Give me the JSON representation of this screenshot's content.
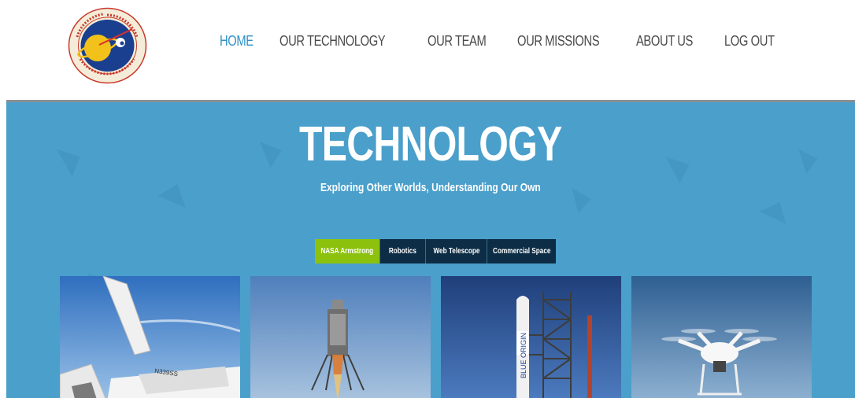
{
  "nav": {
    "items": [
      {
        "label": "HOME",
        "active": true
      },
      {
        "label": "OUR TECHNOLOGY",
        "active": false
      },
      {
        "label": "OUR TEAM",
        "active": false
      },
      {
        "label": "OUR MISSIONS",
        "active": false
      },
      {
        "label": "ABOUT US",
        "active": false
      },
      {
        "label": "LOG OUT",
        "active": false
      }
    ]
  },
  "hero": {
    "title": "TECHNOLOGY",
    "subtitle": "Exploring Other Worlds, Understanding Our Own"
  },
  "tabs": [
    {
      "label": "NASA Armstrong",
      "active": true
    },
    {
      "label": "Robotics",
      "active": false
    },
    {
      "label": "Web Telescope",
      "active": false
    },
    {
      "label": "Commercial Space",
      "active": false
    }
  ],
  "cards": [
    {
      "subject": "spaceplane"
    },
    {
      "subject": "lander"
    },
    {
      "subject": "rocket"
    },
    {
      "subject": "drone"
    }
  ],
  "colors": {
    "accent": "#2e8fc6",
    "hero_bg": "#4a9fcb",
    "tab_active": "#8cc10d",
    "tab_inactive": "#0c2d45"
  }
}
